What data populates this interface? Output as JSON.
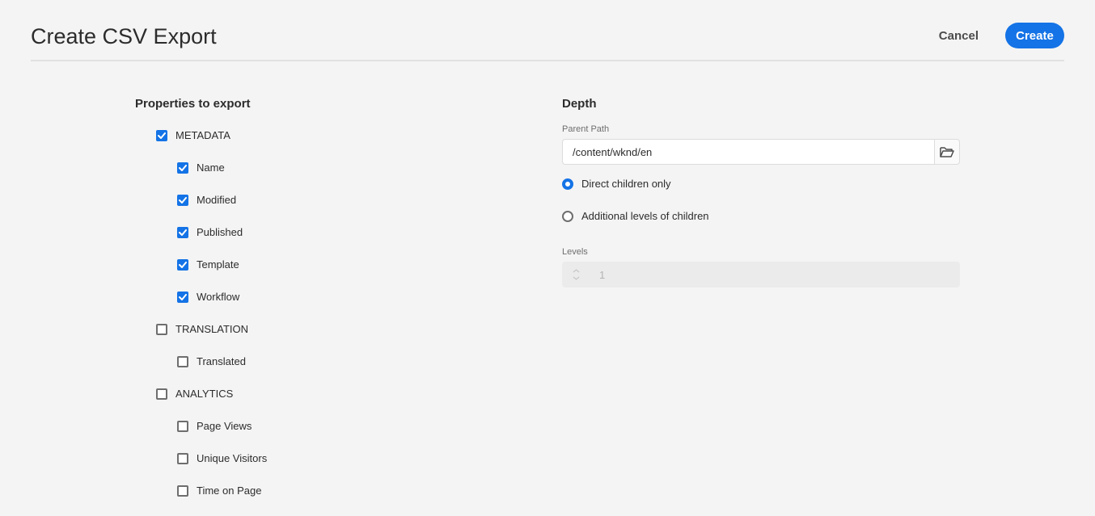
{
  "header": {
    "title": "Create CSV Export",
    "cancel_label": "Cancel",
    "create_label": "Create"
  },
  "properties": {
    "heading": "Properties to export",
    "groups": [
      {
        "label": "METADATA",
        "checked": true,
        "items": [
          {
            "label": "Name",
            "checked": true
          },
          {
            "label": "Modified",
            "checked": true
          },
          {
            "label": "Published",
            "checked": true
          },
          {
            "label": "Template",
            "checked": true
          },
          {
            "label": "Workflow",
            "checked": true
          }
        ]
      },
      {
        "label": "TRANSLATION",
        "checked": false,
        "items": [
          {
            "label": "Translated",
            "checked": false
          }
        ]
      },
      {
        "label": "ANALYTICS",
        "checked": false,
        "items": [
          {
            "label": "Page Views",
            "checked": false
          },
          {
            "label": "Unique Visitors",
            "checked": false
          },
          {
            "label": "Time on Page",
            "checked": false
          }
        ]
      }
    ]
  },
  "depth": {
    "heading": "Depth",
    "parent_path_label": "Parent Path",
    "parent_path_value": "/content/wknd/en",
    "options": [
      {
        "label": "Direct children only",
        "selected": true
      },
      {
        "label": "Additional levels of children",
        "selected": false
      }
    ],
    "levels_label": "Levels",
    "levels_value": "1"
  },
  "colors": {
    "accent": "#1473e6",
    "background": "#f4f4f4",
    "text": "#2c2c2c",
    "muted": "#6e6e6e"
  },
  "icons": {
    "checkbox_checked": "checkmark-icon",
    "browse": "folder-icon",
    "stepper_up": "chevron-up-icon",
    "stepper_down": "chevron-down-icon"
  }
}
